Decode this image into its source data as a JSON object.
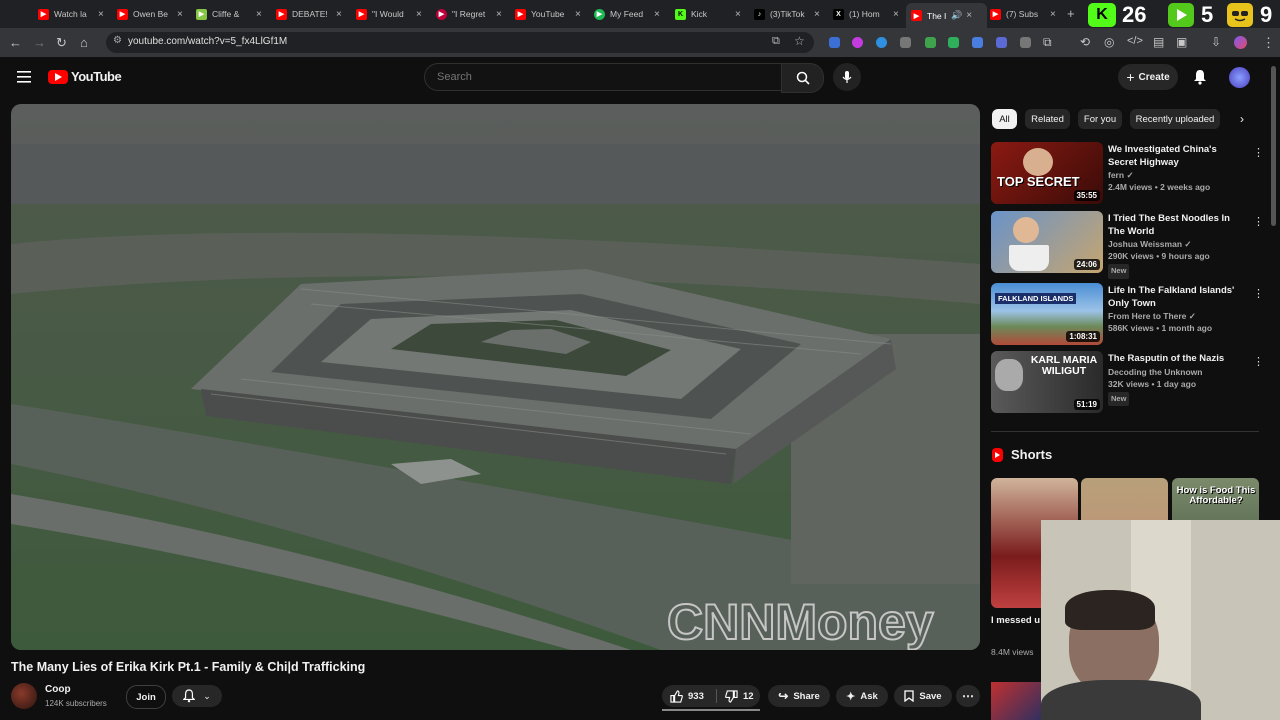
{
  "browser": {
    "tabs": [
      {
        "title": "Watch la",
        "icon": "youtube-icon"
      },
      {
        "title": "Owen Be",
        "icon": "youtube-icon"
      },
      {
        "title": "Cliffe &",
        "icon": "rumble-icon"
      },
      {
        "title": "DEBATE!",
        "icon": "youtube-icon"
      },
      {
        "title": "\"I Would",
        "icon": "youtube-icon"
      },
      {
        "title": "\"I Regret",
        "icon": "youtube-icon"
      },
      {
        "title": "YouTube",
        "icon": "youtube-icon"
      },
      {
        "title": "My Feed",
        "icon": "feed-icon"
      },
      {
        "title": "Kick",
        "icon": "kick-icon"
      },
      {
        "title": "(3)TikTok",
        "icon": "tiktok-icon"
      },
      {
        "title": "(1) Hom",
        "icon": "x-icon"
      },
      {
        "title": "The I",
        "icon": "youtube-icon"
      },
      {
        "title": "(7) Subs",
        "icon": "youtube-icon"
      }
    ],
    "url": "youtube.com/watch?v=5_fx4LlGf1M",
    "overlay_numbers": [
      "26",
      "5",
      "9"
    ]
  },
  "youtube": {
    "logo_text": "YouTube",
    "search_placeholder": "Search",
    "create_label": "Create"
  },
  "video": {
    "watermark": "CNNMoney",
    "title": "The Many Lies of Erika Kirk Pt.1 - Family & Chi|d Trafficking",
    "channel": "Coop",
    "subscribers": "124K subscribers",
    "join_label": "Join",
    "likes": "933",
    "dislikes": "12",
    "share_label": "Share",
    "ask_label": "Ask",
    "save_label": "Save"
  },
  "chips": [
    "All",
    "Related",
    "For you",
    "Recently uploaded"
  ],
  "recommendations": [
    {
      "title": "We Investigated China's Secret Highway",
      "channel": "fern",
      "meta": "2.4M views • 2 weeks ago",
      "duration": "35:55",
      "thumb_text": "TOP SECRET",
      "new": false
    },
    {
      "title": "I Tried The Best Noodles In The World",
      "channel": "Joshua Weissman",
      "meta": "290K views • 9 hours ago",
      "duration": "24:06",
      "thumb_text": "",
      "new": true,
      "new_label": "New"
    },
    {
      "title": "Life In The Falkland Islands' Only Town",
      "channel": "From Here to There",
      "meta": "586K views • 1 month ago",
      "duration": "1:08:31",
      "thumb_text": "FALKLAND ISLANDS",
      "new": false
    },
    {
      "title": "The Rasputin of the Nazis",
      "channel": "Decoding the Unknown",
      "meta": "32K views • 1 day ago",
      "duration": "51:19",
      "thumb_text": "KARL MARIA WILIGUT",
      "new": true,
      "new_label": "New"
    }
  ],
  "shorts": {
    "heading": "Shorts",
    "items": [
      {
        "title": "I messed u",
        "views": "8.4M views",
        "thumb_text": ""
      },
      {
        "title": "",
        "views": "",
        "thumb_text": ""
      },
      {
        "title": "",
        "views": "",
        "thumb_text": "How is Food This Affordable?"
      }
    ]
  },
  "colors": {
    "accent": "#ff0000",
    "bg": "#0f0f0f",
    "chip": "#272727"
  }
}
